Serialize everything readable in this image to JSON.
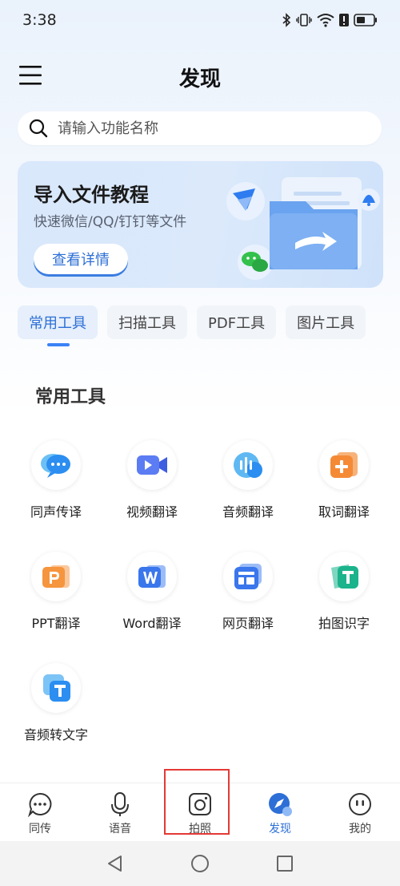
{
  "status_bar": {
    "time": "3:38"
  },
  "header": {
    "title": "发现"
  },
  "search": {
    "placeholder": "请输入功能名称"
  },
  "banner": {
    "title": "导入文件教程",
    "subtitle": "快速微信/QQ/钉钉等文件",
    "button_label": "查看详情"
  },
  "tabs": [
    {
      "label": "常用工具",
      "active": true
    },
    {
      "label": "扫描工具"
    },
    {
      "label": "PDF工具"
    },
    {
      "label": "图片工具"
    }
  ],
  "section": {
    "title": "常用工具"
  },
  "tools": [
    {
      "label": "同声传译",
      "icon": "chat-bubbles-icon"
    },
    {
      "label": "视频翻译",
      "icon": "video-camera-icon"
    },
    {
      "label": "音频翻译",
      "icon": "audio-wave-icon"
    },
    {
      "label": "取词翻译",
      "icon": "word-pick-icon"
    },
    {
      "label": "PPT翻译",
      "icon": "ppt-icon"
    },
    {
      "label": "Word翻译",
      "icon": "word-icon"
    },
    {
      "label": "网页翻译",
      "icon": "webpage-icon"
    },
    {
      "label": "拍图识字",
      "icon": "photo-text-icon"
    },
    {
      "label": "音频转文字",
      "icon": "audio-to-text-icon"
    }
  ],
  "bottom_nav": [
    {
      "label": "同传",
      "icon": "chat-icon"
    },
    {
      "label": "语音",
      "icon": "microphone-icon"
    },
    {
      "label": "拍照",
      "icon": "camera-icon"
    },
    {
      "label": "发现",
      "icon": "discover-icon",
      "active": true
    },
    {
      "label": "我的",
      "icon": "profile-icon"
    }
  ],
  "colors": {
    "accent": "#2d6fd6",
    "highlight": "#e53935"
  }
}
